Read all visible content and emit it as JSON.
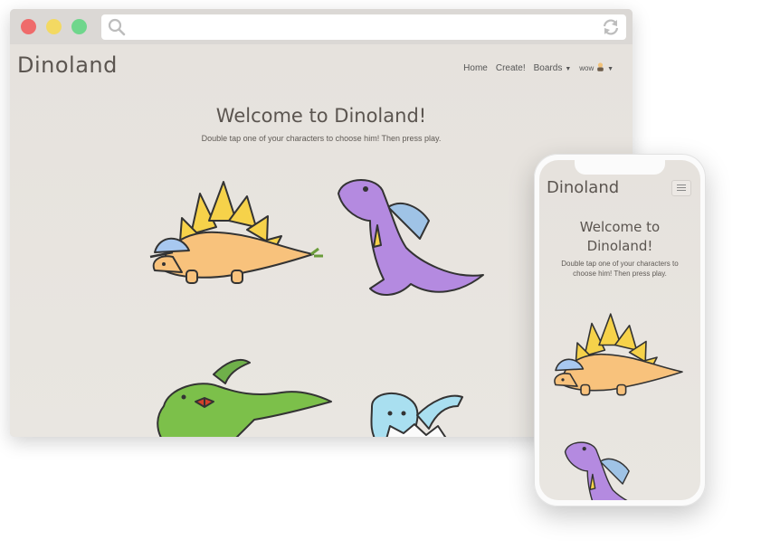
{
  "desktop": {
    "brand": "Dinoland",
    "nav": {
      "home": "Home",
      "create": "Create!",
      "boards": "Boards",
      "user": "wow"
    },
    "welcome": "Welcome to Dinoland!",
    "subtitle": "Double tap one of your characters to choose him! Then press play."
  },
  "mobile": {
    "brand": "Dinoland",
    "welcome": "Welcome to Dinoland!",
    "subtitle": "Double tap one of your characters to choose him! Then press play."
  },
  "window_controls": {
    "close": "#ef6b6b",
    "minimize": "#f3d962",
    "maximize": "#6fd68c"
  },
  "icons": [
    "search-icon",
    "reload-icon",
    "caret-down-icon",
    "hamburger-menu-icon",
    "user-avatar-icon"
  ],
  "characters": [
    "stegosaurus",
    "spinosaurus",
    "parasaurolophus",
    "baby-dino-in-egg"
  ]
}
